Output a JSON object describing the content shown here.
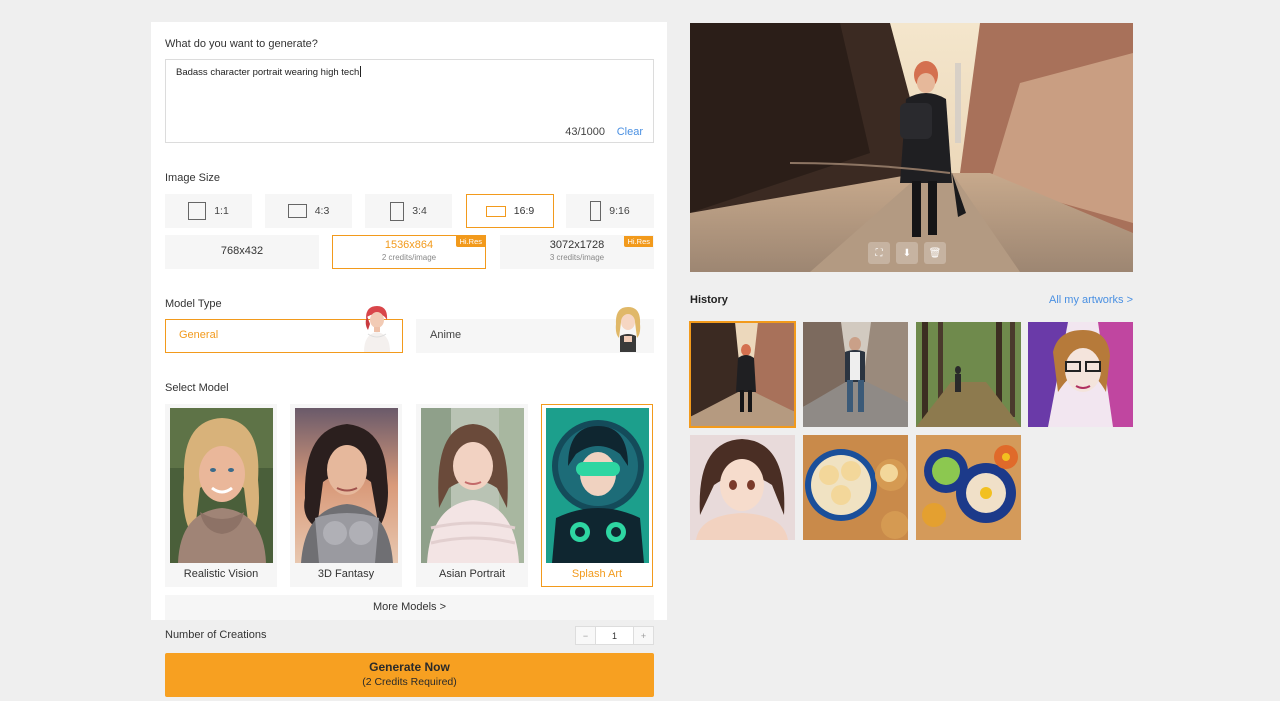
{
  "prompt": {
    "label": "What do you want to generate?",
    "value": "Badass character portrait wearing high tech",
    "count": "43/1000",
    "clear_label": "Clear"
  },
  "image_size": {
    "label": "Image Size",
    "ratios": [
      "1:1",
      "4:3",
      "3:4",
      "16:9",
      "9:16"
    ],
    "selected_ratio": "16:9",
    "resolutions": [
      {
        "size": "768x432",
        "credits": "",
        "badge": ""
      },
      {
        "size": "1536x864",
        "credits": "2 credits/image",
        "badge": "Hi.Res"
      },
      {
        "size": "3072x1728",
        "credits": "3 credits/image",
        "badge": "Hi.Res"
      }
    ],
    "selected_resolution": "1536x864"
  },
  "model_type": {
    "label": "Model Type",
    "options": [
      "General",
      "Anime"
    ],
    "selected": "General"
  },
  "select_model": {
    "label": "Select Model",
    "models": [
      "Realistic Vision",
      "3D Fantasy",
      "Asian Portrait",
      "Splash Art"
    ],
    "selected": "Splash Art",
    "more_label": "More Models >"
  },
  "creations": {
    "label": "Number of Creations",
    "value": "1",
    "minus": "−",
    "plus": "+"
  },
  "generate": {
    "title": "Generate Now",
    "subtitle": "(2 Credits Required)",
    "color": "#f7a021"
  },
  "history": {
    "title": "History",
    "all_link": "All my artworks >"
  },
  "colors": {
    "accent": "#f29a1c",
    "link": "#4a90e2"
  }
}
